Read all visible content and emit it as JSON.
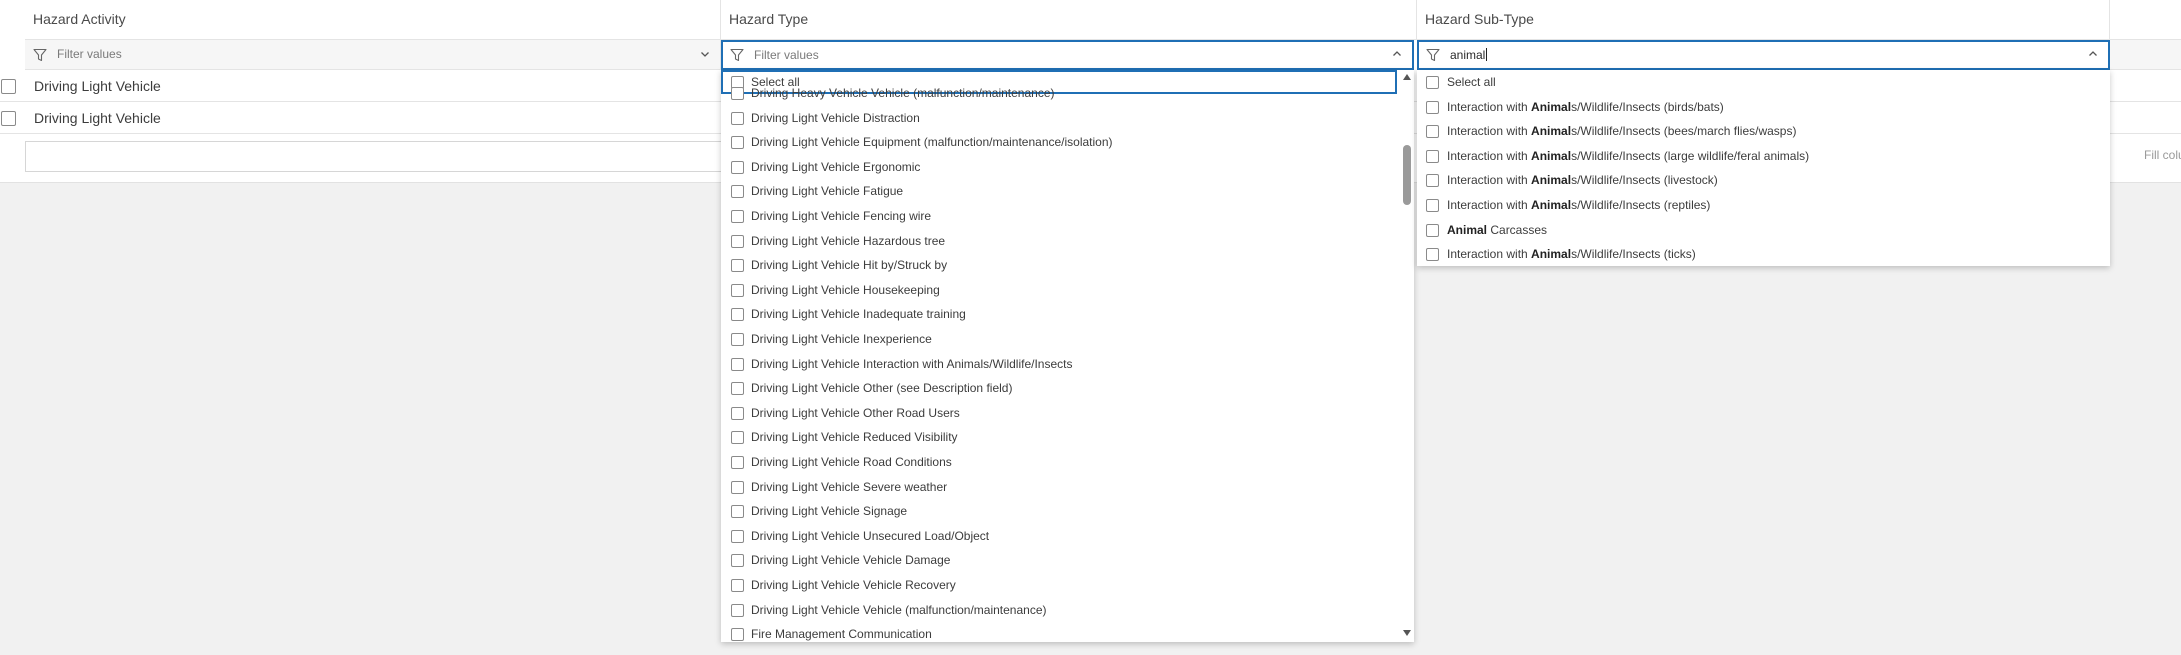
{
  "columns": {
    "a": "Hazard Activity",
    "b": "Hazard Type",
    "c": "Hazard Sub-Type"
  },
  "filters": {
    "a_placeholder": "Filter values",
    "b_placeholder": "Filter values",
    "c_value": "animal"
  },
  "rows": [
    "Driving Light Vehicle",
    "Driving Light Vehicle"
  ],
  "footer": {
    "fill_hint": "Fill colu"
  },
  "hazard_type_dropdown": {
    "select_all": "Select all",
    "options": [
      "Driving Heavy Vehicle Vehicle (malfunction/maintenance)",
      "Driving Light Vehicle Distraction",
      "Driving Light Vehicle Equipment (malfunction/maintenance/isolation)",
      "Driving Light Vehicle Ergonomic",
      "Driving Light Vehicle Fatigue",
      "Driving Light Vehicle Fencing wire",
      "Driving Light Vehicle Hazardous tree",
      "Driving Light Vehicle Hit by/Struck by",
      "Driving Light Vehicle Housekeeping",
      "Driving Light Vehicle Inadequate training",
      "Driving Light Vehicle Inexperience",
      "Driving Light Vehicle Interaction with Animals/Wildlife/Insects",
      "Driving Light Vehicle Other (see Description field)",
      "Driving Light Vehicle Other Road Users",
      "Driving Light Vehicle Reduced Visibility",
      "Driving Light Vehicle Road Conditions",
      "Driving Light Vehicle Severe weather",
      "Driving Light Vehicle Signage",
      "Driving Light Vehicle Unsecured Load/Object",
      "Driving Light Vehicle Vehicle Damage",
      "Driving Light Vehicle Vehicle Recovery",
      "Driving Light Vehicle Vehicle (malfunction/maintenance)",
      "Fire Management Communication"
    ]
  },
  "sub_type_dropdown": {
    "select_all": "Select all",
    "options": [
      {
        "pre": "Interaction with ",
        "match": "Animal",
        "post": "s/Wildlife/Insects (birds/bats)"
      },
      {
        "pre": "Interaction with ",
        "match": "Animal",
        "post": "s/Wildlife/Insects (bees/march flies/wasps)"
      },
      {
        "pre": "Interaction with ",
        "match": "Animal",
        "post": "s/Wildlife/Insects (large wildlife/feral animals)"
      },
      {
        "pre": "Interaction with ",
        "match": "Animal",
        "post": "s/Wildlife/Insects (livestock)"
      },
      {
        "pre": "Interaction with ",
        "match": "Animal",
        "post": "s/Wildlife/Insects (reptiles)"
      },
      {
        "pre": "",
        "match": "Animal",
        "post": " Carcasses"
      },
      {
        "pre": "Interaction with ",
        "match": "Animal",
        "post": "s/Wildlife/Insects (ticks)"
      }
    ]
  },
  "colors": {
    "focus": "#1f6fb5",
    "text": "#3c3c3c"
  },
  "icons": {
    "filter": "funnel-icon",
    "dropdown": "chevron-icon",
    "checkbox": "checkbox-icon"
  }
}
